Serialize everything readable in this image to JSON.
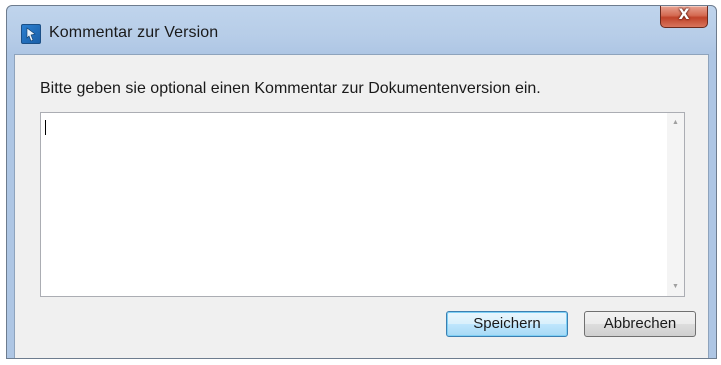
{
  "window": {
    "title": "Kommentar zur Version",
    "close_symbol": "X",
    "icon": "app-icon"
  },
  "dialog": {
    "prompt": "Bitte geben sie optional einen Kommentar zur Dokumentenversion ein.",
    "comment_value": "",
    "scroll_up_symbol": "▲",
    "scroll_down_symbol": "▼"
  },
  "buttons": {
    "save_label": "Speichern",
    "cancel_label": "Abbrechen"
  },
  "colors": {
    "title_bar": "#b7cde8",
    "close_button": "#c0432a",
    "client_background": "#f0f0f0",
    "focused_button_border": "#3c7fb1"
  }
}
